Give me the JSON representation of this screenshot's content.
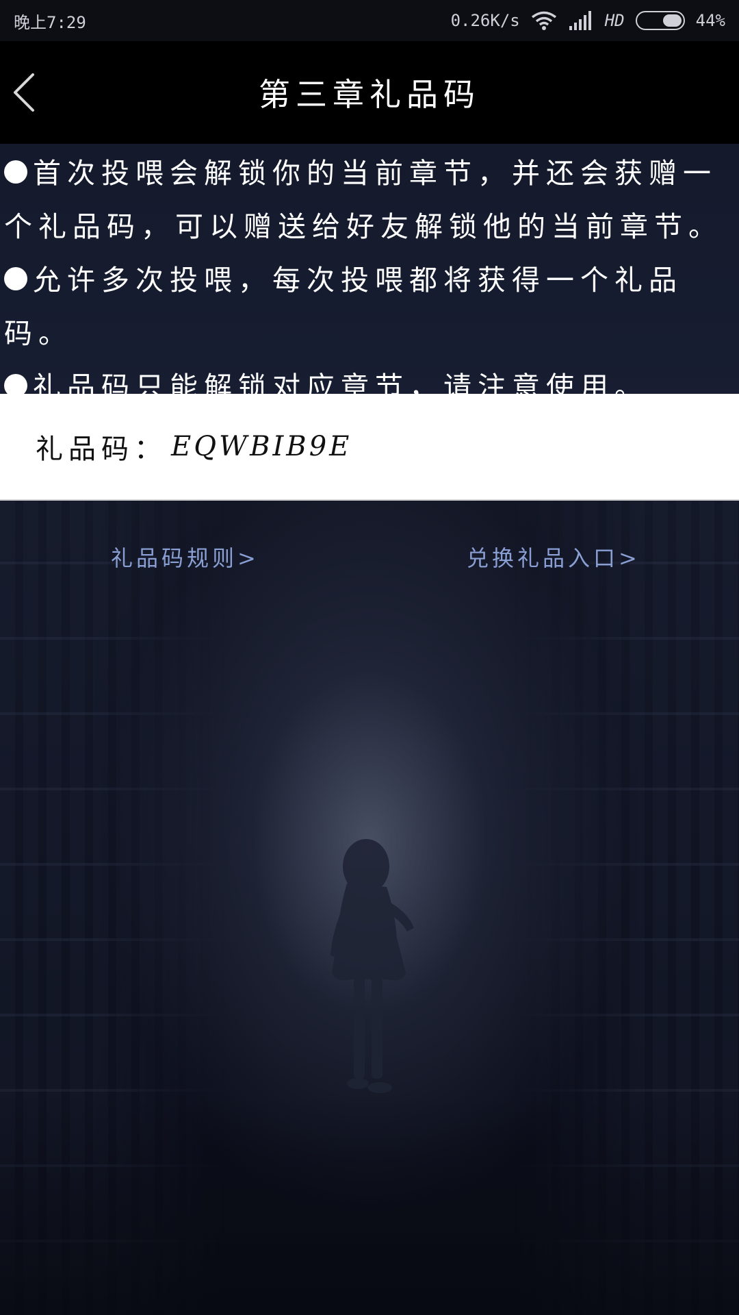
{
  "status_bar": {
    "time": "晚上7:29",
    "network_speed": "0.26K/s",
    "hd": "HD",
    "battery_percent": "44%",
    "battery_level": 0.44
  },
  "header": {
    "title": "第三章礼品码"
  },
  "rules": [
    "首次投喂会解锁你的当前章节，并还会获赠一个礼品码，可以赠送给好友解锁他的当前章节。",
    "允许多次投喂，每次投喂都将获得一个礼品码。",
    "礼品码只能解锁对应章节，请注意使用。"
  ],
  "gift_code": {
    "label": "礼品码：",
    "value": "EQWBIB9E"
  },
  "links": {
    "rules_label": "礼品码规则>",
    "redeem_label": "兑换礼品入口>"
  },
  "colors": {
    "link": "#8a9fd4",
    "header_bg": "#000000",
    "card_bg": "#ffffff"
  }
}
